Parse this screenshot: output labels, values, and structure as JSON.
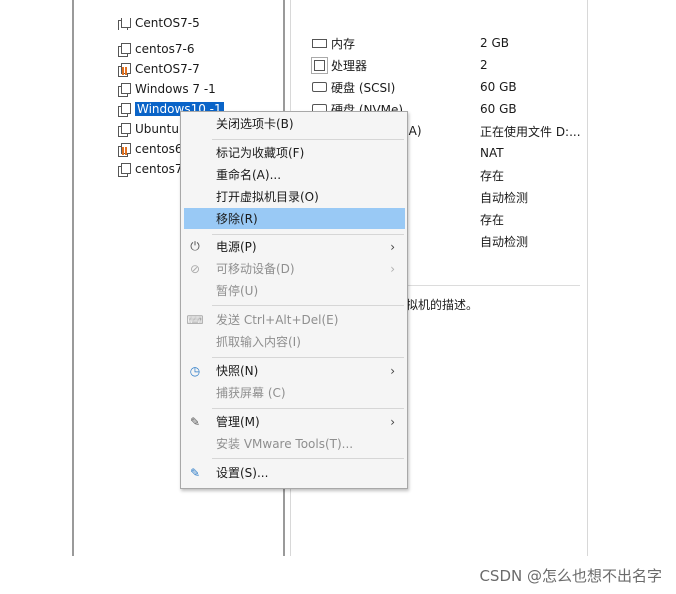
{
  "vm_list": [
    {
      "name": "CentOS7-5",
      "running": false
    },
    {
      "name": "centos7-6",
      "running": false
    },
    {
      "name": "CentOS7-7",
      "running": true
    },
    {
      "name": "Windows 7 -1",
      "running": false
    },
    {
      "name": "Windows10 -1",
      "running": false,
      "selected": true
    },
    {
      "name": "Ubuntu",
      "running": false
    },
    {
      "name": "centos6",
      "running": true
    },
    {
      "name": "centos7",
      "running": false
    }
  ],
  "devices": [
    {
      "name": "内存",
      "value": "2 GB",
      "icon": "memory-icon"
    },
    {
      "name": "处理器",
      "value": "2",
      "icon": "cpu-icon"
    },
    {
      "name": "硬盘 (SCSI)",
      "value": "60 GB",
      "icon": "disk-icon"
    },
    {
      "name": "硬盘 (NVMe)",
      "value": "60 GB",
      "icon": "disk-icon"
    },
    {
      "name": "(A)",
      "value": "正在使用文件 D:...",
      "icon": ""
    },
    {
      "name": "",
      "value": "NAT",
      "icon": ""
    },
    {
      "name": "",
      "value": "存在",
      "icon": ""
    },
    {
      "name": "",
      "value": "自动检测",
      "icon": ""
    },
    {
      "name": "",
      "value": "存在",
      "icon": ""
    },
    {
      "name": "",
      "value": "自动检测",
      "icon": ""
    }
  ],
  "description_partial": "拟机的描述。",
  "context_menu": {
    "close_tab": "关闭选项卡(B)",
    "mark_favorite": "标记为收藏项(F)",
    "rename": "重命名(A)...",
    "open_dir": "打开虚拟机目录(O)",
    "remove": "移除(R)",
    "power": "电源(P)",
    "removable_devices": "可移动设备(D)",
    "pause": "暂停(U)",
    "send_cad": "发送 Ctrl+Alt+Del(E)",
    "grab_input": "抓取输入内容(I)",
    "snapshot": "快照(N)",
    "capture_screen": "捕获屏幕 (C)",
    "manage": "管理(M)",
    "install_tools": "安装 VMware Tools(T)...",
    "settings": "设置(S)..."
  },
  "watermark": "CSDN @怎么也想不出名字",
  "colors": {
    "selection": "#0a64c8",
    "menu_highlight": "#99c9f5",
    "running_indicator": "#e0701f"
  }
}
